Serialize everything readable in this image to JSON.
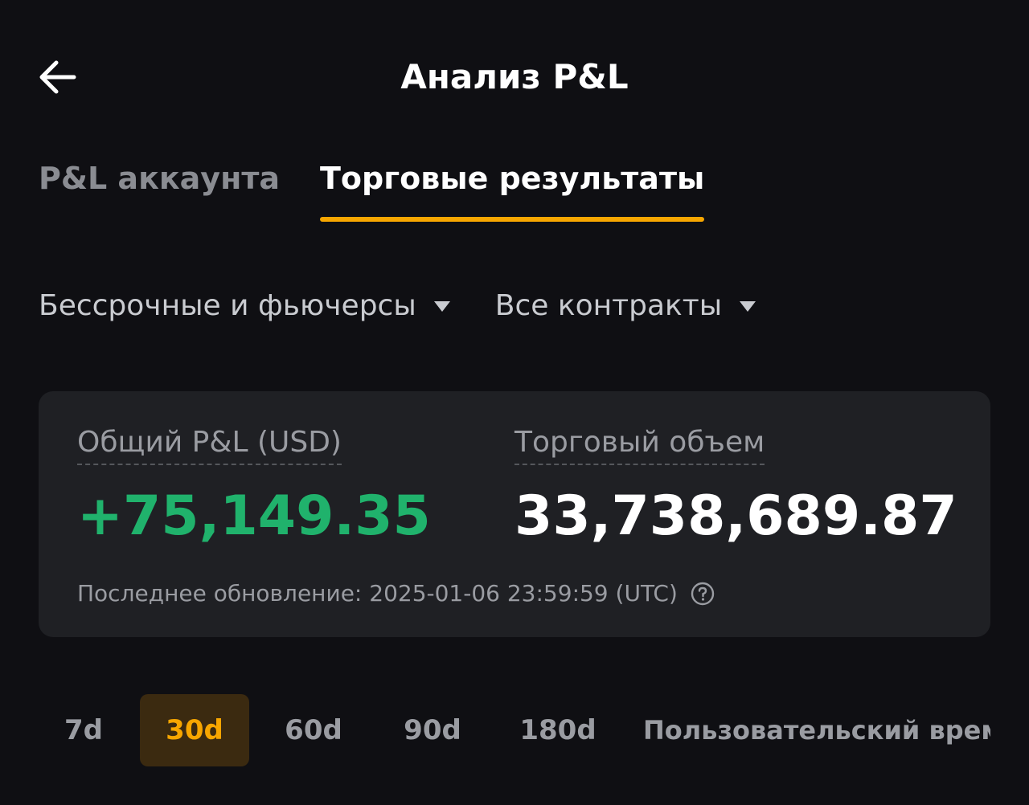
{
  "header": {
    "title": "Анализ P&L",
    "back_icon": "arrow-left-icon"
  },
  "tabs": [
    {
      "label": "P&L аккаунта",
      "active": false
    },
    {
      "label": "Торговые результаты",
      "active": true
    }
  ],
  "filters": {
    "product": "Бессрочные и фьючерсы",
    "contracts": "Все контракты"
  },
  "summary": {
    "pnl_label": "Общий P&L (USD)",
    "pnl_value": "+75,149.35",
    "volume_label": "Торговый объем",
    "volume_value": "33,738,689.87",
    "updated": "Последнее обновление: 2025-01-06 23:59:59 (UTC)"
  },
  "periods": [
    {
      "label": "7d",
      "active": false
    },
    {
      "label": "30d",
      "active": true
    },
    {
      "label": "60d",
      "active": false
    },
    {
      "label": "90d",
      "active": false
    },
    {
      "label": "180d",
      "active": false
    },
    {
      "label": "Пользовательский врем",
      "active": false
    }
  ],
  "colors": {
    "background": "#0f0f13",
    "card": "#1f2024",
    "accent": "#f7a600",
    "positive": "#20b26c"
  }
}
